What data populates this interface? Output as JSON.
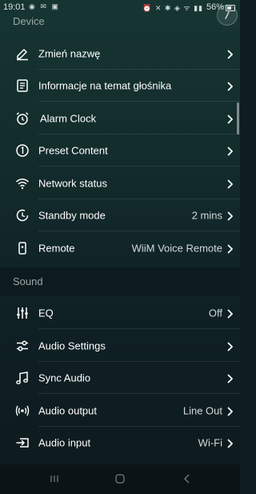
{
  "status_bar": {
    "time": "19:01",
    "battery": "56%",
    "left_icons": [
      "whatsapp-icon",
      "mail-icon",
      "image-icon"
    ],
    "right_icons": [
      "alarm-icon",
      "mute-icon",
      "bluetooth-icon",
      "nfc-icon",
      "wifi-icon",
      "signal-icon",
      "signal-icon"
    ]
  },
  "sections": {
    "device": "Device",
    "sound": "Sound"
  },
  "device_items": [
    {
      "label": "Zmień nazwę",
      "value": "",
      "icon": "edit-icon"
    },
    {
      "label": "Informacje na temat głośnika",
      "value": "",
      "icon": "document-icon"
    },
    {
      "label": "Alarm Clock",
      "value": "",
      "icon": "alarm-clock-icon"
    },
    {
      "label": "Preset Content",
      "value": "",
      "icon": "preset-number-icon"
    },
    {
      "label": "Network status",
      "value": "",
      "icon": "wifi-icon"
    },
    {
      "label": "Standby mode",
      "value": "2 mins",
      "icon": "standby-timer-icon"
    },
    {
      "label": "Remote",
      "value": "WiiM Voice Remote",
      "icon": "remote-icon"
    }
  ],
  "sound_items": [
    {
      "label": "EQ",
      "value": "Off",
      "icon": "equalizer-icon"
    },
    {
      "label": "Audio Settings",
      "value": "",
      "icon": "audio-settings-icon"
    },
    {
      "label": "Sync Audio",
      "value": "",
      "icon": "music-note-icon"
    },
    {
      "label": "Audio output",
      "value": "Line Out",
      "icon": "audio-output-icon"
    },
    {
      "label": "Audio input",
      "value": "Wi-Fi",
      "icon": "audio-input-icon"
    }
  ],
  "colors": {
    "background_top": "#163532",
    "background_bottom": "#0d1a1e",
    "section_header": "#9aa8a8",
    "text": "#ffffff",
    "value_text": "#d4dada"
  },
  "nav_bar": [
    "recents-icon",
    "home-icon",
    "back-icon"
  ]
}
